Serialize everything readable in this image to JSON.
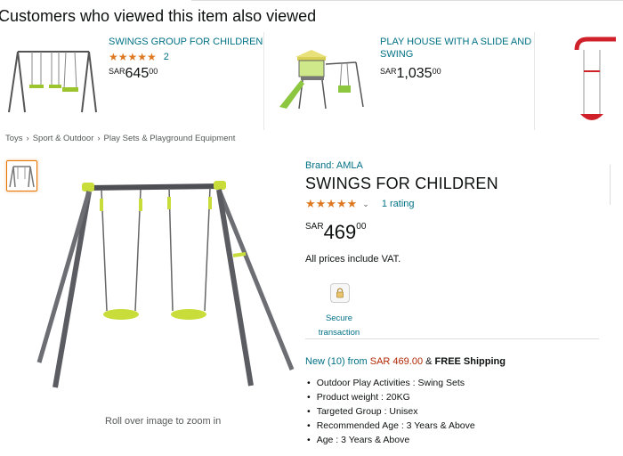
{
  "carousel": {
    "title": "Customers who viewed this item also viewed",
    "items": [
      {
        "title": "SWINGS GROUP FOR CHILDREN",
        "stars": "★★★★★",
        "rating_count": "2",
        "currency": "SAR",
        "whole": "645",
        "fraction": "00"
      },
      {
        "title_line1": "PLAY HOUSE WITH A SLIDE AND",
        "title_line2": "SWING",
        "currency": "SAR",
        "whole": "1,035",
        "fraction": "00"
      }
    ]
  },
  "breadcrumb": [
    "Toys",
    "Sport & Outdoor",
    "Play Sets & Playground Equipment"
  ],
  "product": {
    "brand": "Brand: AMLA",
    "title": "SWINGS FOR CHILDREN",
    "stars": "★★★★★",
    "rating_text": "1 rating",
    "currency": "SAR",
    "price_whole": "469",
    "price_fraction": "00",
    "vat": "All prices include VAT.",
    "secure_line1": "Secure",
    "secure_line2": "transaction",
    "new_prefix": "New (10) from ",
    "new_price": "SAR 469.00",
    "new_amp": " & ",
    "free_shipping": "FREE Shipping",
    "bullets": [
      "Outdoor Play Activities : Swing Sets",
      "Product weight : 20KG",
      "Targeted Group : Unisex",
      "Recommended Age : 3 Years & Above",
      "Age : 3 Years & Above"
    ],
    "zoom_hint": "Roll over image to zoom in"
  },
  "colors": {
    "link": "#007185",
    "star": "#de7921",
    "price_red": "#b12704",
    "thumb_border": "#e77600"
  }
}
